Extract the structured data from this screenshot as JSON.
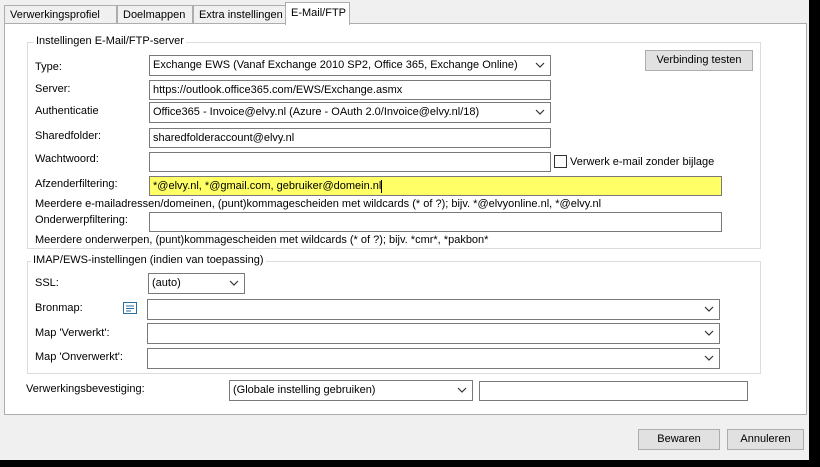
{
  "tabs": [
    "Verwerkingsprofiel",
    "Doelmappen",
    "Extra instellingen",
    "E-Mail/FTP"
  ],
  "server_group": {
    "legend": "Instellingen E-Mail/FTP-server",
    "test_button": "Verbinding testen",
    "type": {
      "label": "Type:",
      "value": "Exchange EWS (Vanaf Exchange 2010 SP2, Office 365, Exchange Online)"
    },
    "server": {
      "label": "Server:",
      "value": "https://outlook.office365.com/EWS/Exchange.asmx"
    },
    "auth": {
      "label": "Authenticatie",
      "value": "Office365 - Invoice@elvy.nl (Azure - OAuth 2.0/Invoice@elvy.nl/18)"
    },
    "shared": {
      "label": "Sharedfolder:",
      "value": "sharedfolderaccount@elvy.nl"
    },
    "password": {
      "label": "Wachtwoord:",
      "value": ""
    },
    "no_attachment": {
      "label": "Verwerk e-mail zonder bijlage",
      "checked": false
    },
    "sender": {
      "label": "Afzenderfiltering:",
      "value": "*@elvy.nl, *@gmail.com, gebruiker@domein.nl",
      "hint": "Meerdere e-mailadressen/domeinen, (punt)kommagescheiden met wildcards (* of ?); bijv. *@elvyonline.nl, *@elvy.nl"
    },
    "subject": {
      "label": "Onderwerpfiltering:",
      "value": "",
      "hint": "Meerdere onderwerpen, (punt)kommagescheiden met wildcards (* of ?); bijv. *cmr*, *pakbon*"
    }
  },
  "imap_group": {
    "legend": "IMAP/EWS-instellingen (indien van toepassing)",
    "ssl": {
      "label": "SSL:",
      "value": "(auto)"
    },
    "source": {
      "label": "Bronmap:",
      "value": ""
    },
    "processed": {
      "label": "Map 'Verwerkt':",
      "value": ""
    },
    "unprocessed": {
      "label": "Map 'Onverwerkt':",
      "value": ""
    }
  },
  "confirmation": {
    "label": "Verwerkingsbevestiging:",
    "value": "(Globale instelling gebruiken)",
    "extra": ""
  },
  "buttons": {
    "save": "Bewaren",
    "cancel": "Annuleren"
  },
  "colors": {
    "highlight": "#ffff66"
  }
}
